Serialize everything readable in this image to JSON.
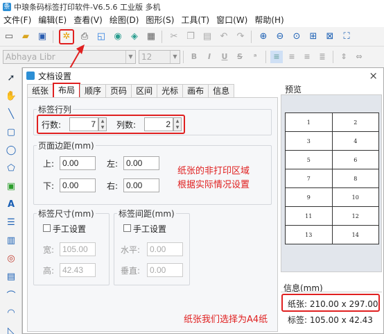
{
  "titlebar": {
    "title": "中琅条码标签打印软件-V6.5.6 工业版 多机"
  },
  "menu": [
    "文件(F)",
    "编辑(E)",
    "查看(V)",
    "绘图(D)",
    "图形(S)",
    "工具(T)",
    "窗口(W)",
    "帮助(H)"
  ],
  "toolbar2": {
    "font_name": "Abhaya Libr",
    "font_size": "12"
  },
  "dialog": {
    "title": "文档设置",
    "close": "×",
    "tabs": [
      "纸张",
      "布局",
      "顺序",
      "页码",
      "区间",
      "光标",
      "画布",
      "信息"
    ],
    "active_tab": "布局",
    "rows_cols": {
      "legend": "标签行列",
      "rows_label": "行数:",
      "rows_value": "7",
      "cols_label": "列数:",
      "cols_value": "2"
    },
    "margins": {
      "legend": "页面边距(mm)",
      "top_label": "上:",
      "top_value": "0.00",
      "left_label": "左:",
      "left_value": "0.00",
      "bottom_label": "下:",
      "bottom_value": "0.00",
      "right_label": "右:",
      "right_value": "0.00"
    },
    "label_size": {
      "legend": "标签尺寸(mm)",
      "manual_label": "手工设置",
      "width_label": "宽:",
      "width_value": "105.00",
      "height_label": "高:",
      "height_value": "42.43"
    },
    "label_spacing": {
      "legend": "标签间距(mm)",
      "manual_label": "手工设置",
      "h_label": "水平:",
      "h_value": "0.00",
      "v_label": "垂直:",
      "v_value": "0.00"
    },
    "preview": {
      "legend": "预览",
      "cells": [
        [
          "1",
          "2"
        ],
        [
          "3",
          "4"
        ],
        [
          "5",
          "6"
        ],
        [
          "7",
          "8"
        ],
        [
          "9",
          "10"
        ],
        [
          "11",
          "12"
        ],
        [
          "13",
          "14"
        ]
      ]
    },
    "info": {
      "legend": "信息(mm)",
      "paper": "纸张: 210.00 x 297.00",
      "label": "标签: 105.00 x 42.43"
    }
  },
  "annotations": {
    "margin_note_line1": "纸张的非打印区域",
    "margin_note_line2": "根据实际情况设置",
    "paper_note": "纸张我们选择为A4纸"
  },
  "colors": {
    "annotation_red": "#e02020",
    "accent_blue": "#2d8fd5"
  }
}
